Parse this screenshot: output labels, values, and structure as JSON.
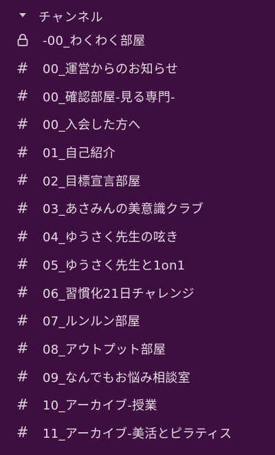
{
  "section": {
    "title": "チャンネル",
    "icon": "caret-down-icon"
  },
  "channels": [
    {
      "icon": "lock-icon",
      "name": "-00_わくわく部屋"
    },
    {
      "icon": "hash-icon",
      "name": "00_運営からのお知らせ"
    },
    {
      "icon": "hash-icon",
      "name": "00_確認部屋-見る専門-"
    },
    {
      "icon": "hash-icon",
      "name": "00_入会した方へ"
    },
    {
      "icon": "hash-icon",
      "name": "01_自己紹介"
    },
    {
      "icon": "hash-icon",
      "name": "02_目標宣言部屋"
    },
    {
      "icon": "hash-icon",
      "name": "03_あさみんの美意識クラブ"
    },
    {
      "icon": "hash-icon",
      "name": "04_ゆうさく先生の呟き"
    },
    {
      "icon": "hash-icon",
      "name": "05_ゆうさく先生と1on1"
    },
    {
      "icon": "hash-icon",
      "name": "06_習慣化21日チャレンジ"
    },
    {
      "icon": "hash-icon",
      "name": "07_ルンルン部屋"
    },
    {
      "icon": "hash-icon",
      "name": "08_アウトプット部屋"
    },
    {
      "icon": "hash-icon",
      "name": "09_なんでもお悩み相談室"
    },
    {
      "icon": "hash-icon",
      "name": "10_アーカイブ-授業"
    },
    {
      "icon": "hash-icon",
      "name": "11_アーカイブ-美活とピラティス"
    }
  ],
  "colors": {
    "background": "#3f0e40",
    "text": "#e6dce6"
  }
}
